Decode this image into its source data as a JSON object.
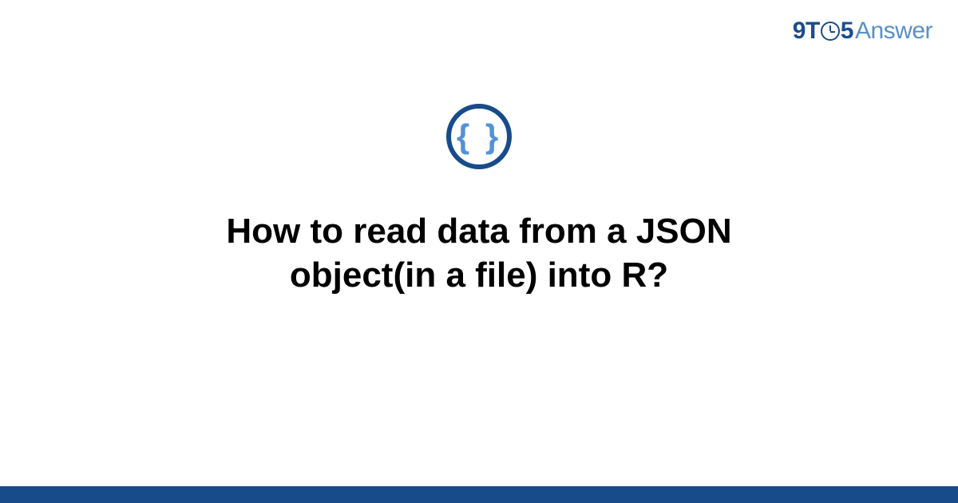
{
  "logo": {
    "nine": "9",
    "t": "T",
    "five": "5",
    "answer": "Answer"
  },
  "icon": {
    "braces": "{ }"
  },
  "title": "How to read data from a JSON object(in a file) into R?",
  "colors": {
    "brand_dark": "#184b8a",
    "brand_light": "#5a8fc7",
    "brace_blue": "#5491d6"
  }
}
